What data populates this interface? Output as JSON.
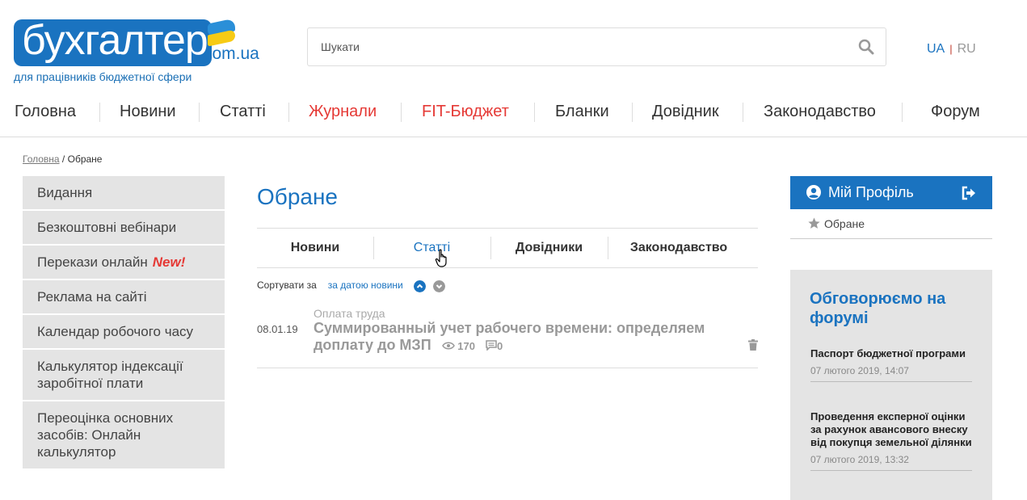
{
  "header": {
    "logo_main": "бухгалтер",
    "logo_domain": "com.ua",
    "tagline": "для працівників бюджетної сфери",
    "search_placeholder": "Шукати",
    "lang_ua": "UA",
    "lang_sep": "|",
    "lang_ru": "RU"
  },
  "nav": {
    "items": [
      {
        "label": "Головна"
      },
      {
        "label": "Новини"
      },
      {
        "label": "Статті"
      },
      {
        "label": "Журнали"
      },
      {
        "label": "FIT-Бюджет"
      },
      {
        "label": "Бланки"
      },
      {
        "label": "Довідник"
      },
      {
        "label": "Законодавство"
      },
      {
        "label": "Форум"
      }
    ],
    "accent_color": "#e53935"
  },
  "breadcrumb": {
    "home": "Головна",
    "sep": " / ",
    "current": "Обране"
  },
  "left_menu": {
    "items": [
      {
        "label": "Видання"
      },
      {
        "label": "Безкоштовні вебінари"
      },
      {
        "label": "Перекази онлайн",
        "badge": "New!"
      },
      {
        "label": "Реклама на сайті"
      },
      {
        "label": "Календар робочого часу"
      },
      {
        "label": "Калькулятор індексації заробітної плати"
      },
      {
        "label": "Переоцінка основних засобів: Онлайн калькулятор"
      }
    ]
  },
  "main": {
    "title": "Обране",
    "tabs": [
      {
        "label": "Новини",
        "active": false
      },
      {
        "label": "Статті",
        "active": true
      },
      {
        "label": "Довідники",
        "active": false
      },
      {
        "label": "Законодавство",
        "active": false
      }
    ],
    "sort_label": "Сортувати за",
    "sort_by": "за датою новини",
    "articles": [
      {
        "date": "08.01.19",
        "category": "Оплата труда",
        "title": "Суммированный учет рабочего времени: определяем доплату до МЗП",
        "views": "170",
        "comments": "0"
      }
    ]
  },
  "right_sidebar": {
    "profile_label": "Мій Профіль",
    "favorites_label": "Обране",
    "forum_title": "Обговорюємо на форумі",
    "forum_items": [
      {
        "title": "Паспорт бюджетної програми",
        "date": "07 лютого 2019, 14:07"
      },
      {
        "title": "Проведення експерної оцінки за рахунок авансового внеску від покупця земельної ділянки",
        "date": "07 лютого 2019, 13:32"
      }
    ]
  },
  "colors": {
    "brand_blue": "#1a73c0",
    "menu_bg": "#e4e4e4",
    "new_badge": "#e53935",
    "flag_yellow": "#f7cb15"
  }
}
